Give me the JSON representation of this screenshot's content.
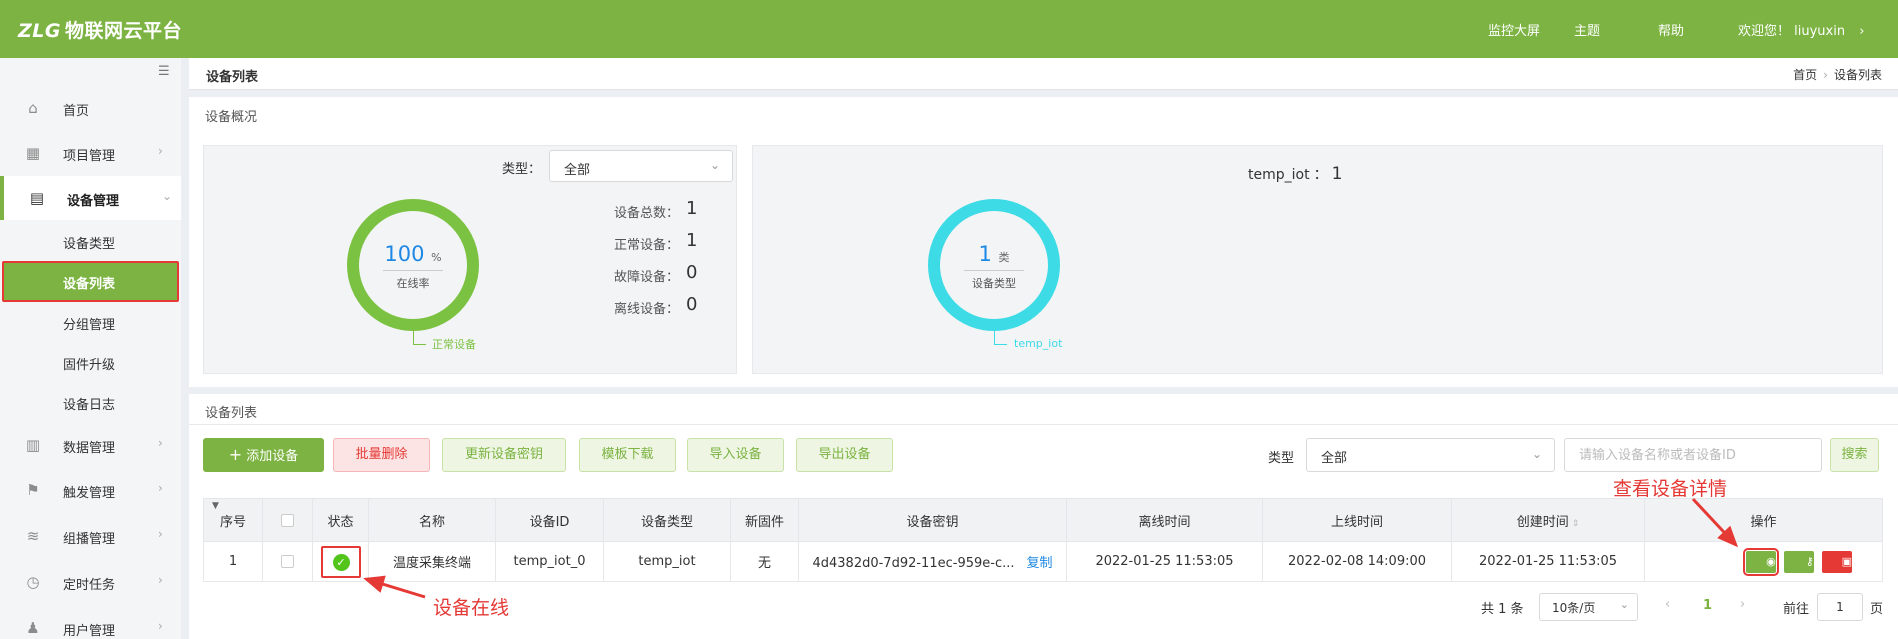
{
  "header": {
    "logo_mark": "ZLG",
    "logo_text": "物联网云平台",
    "nav": [
      "监控大屏",
      "主题",
      "帮助"
    ],
    "welcome": "欢迎您！ liuyuxin",
    "chevron": "›"
  },
  "sidebar": {
    "items": [
      {
        "label": "首页",
        "icon": "home-icon",
        "glyph": "⌂"
      },
      {
        "label": "项目管理",
        "icon": "dashboard-icon",
        "glyph": "▦"
      },
      {
        "label": "设备管理",
        "icon": "device-icon",
        "glyph": "▤"
      },
      {
        "label": "数据管理",
        "icon": "bar-chart-icon",
        "glyph": "▥"
      },
      {
        "label": "触发管理",
        "icon": "flag-icon",
        "glyph": "⚑"
      },
      {
        "label": "组播管理",
        "icon": "layers-icon",
        "glyph": "≋"
      },
      {
        "label": "定时任务",
        "icon": "clock-icon",
        "glyph": "◷"
      },
      {
        "label": "用户管理",
        "icon": "user-icon",
        "glyph": "♟"
      }
    ],
    "sub_items": [
      "设备类型",
      "设备列表",
      "分组管理",
      "固件升级",
      "设备日志"
    ],
    "active_item": "设备管理",
    "current_sub": "设备列表"
  },
  "breadcrumb": {
    "title": "设备列表",
    "path": [
      "首页",
      "设备列表"
    ],
    "sep": "›"
  },
  "overview": {
    "title": "设备概况",
    "type_label": "类型：",
    "type_value": "全部",
    "online_rate": "100",
    "rate_unit": "%",
    "rate_caption": "在线率",
    "ring_legend": "正常设备",
    "stats": [
      {
        "label": "设备总数：",
        "value": "1"
      },
      {
        "label": "正常设备：",
        "value": "1"
      },
      {
        "label": "故障设备：",
        "value": "0"
      },
      {
        "label": "离线设备：",
        "value": "0"
      }
    ],
    "type_count": "1",
    "type_unit": "类",
    "type_caption": "设备类型",
    "type_legend": "temp_iot",
    "type_summary_name": "temp_iot",
    "type_summary_value": "1",
    "colors": {
      "online_ring": "#7cc242",
      "type_ring": "#3ddbe6"
    }
  },
  "device_list": {
    "title": "设备列表",
    "buttons": {
      "add": "添加设备",
      "batch_delete": "批量删除",
      "update_key": "更新设备密钥",
      "template": "模板下载",
      "import": "导入设备",
      "export": "导出设备"
    },
    "filter_label": "类型",
    "filter_value": "全部",
    "search_placeholder": "请输入设备名称或者设备ID",
    "search_button": "搜索",
    "columns": [
      "序号",
      "",
      "状态",
      "名称",
      "设备ID",
      "设备类型",
      "新固件",
      "设备密钥",
      "离线时间",
      "上线时间",
      "创建时间",
      "操作"
    ],
    "rows": [
      {
        "index": "1",
        "status": "online",
        "name": "温度采集终端",
        "device_id": "temp_iot_0",
        "type": "temp_iot",
        "new_firmware": "无",
        "key": "4d4382d0-7d92-11ec-959e-c...",
        "copy": "复制",
        "offline_time": "2022-01-25 11:53:05",
        "online_time": "2022-02-08 14:09:00",
        "created_time": "2022-01-25 11:53:05"
      }
    ]
  },
  "pagination": {
    "total": "共 1 条",
    "page_size": "10条/页",
    "current_page": "1",
    "goto_label": "前往",
    "goto_value": "1",
    "page_suffix": "页"
  },
  "annotations": {
    "online": "设备在线",
    "detail": "查看设备详情"
  }
}
